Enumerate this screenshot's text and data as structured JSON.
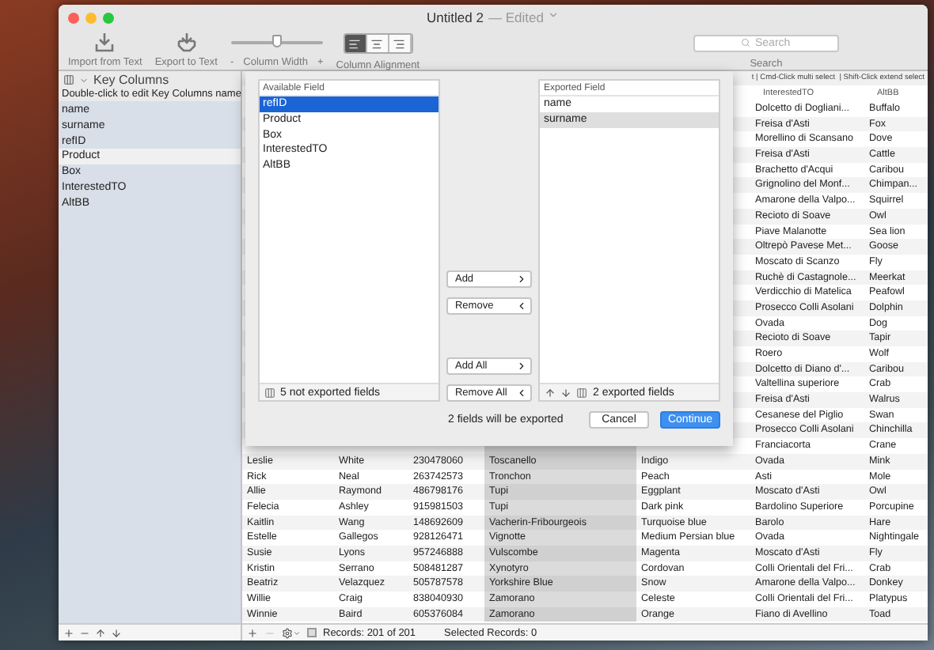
{
  "window": {
    "title": "Untitled 2",
    "edited": "— Edited"
  },
  "toolbar": {
    "import_label": "Import from Text",
    "export_label": "Export to Text",
    "column_width": {
      "label": "Column Width",
      "minus": "-",
      "plus": "+",
      "level": 0.5
    },
    "alignment": {
      "label": "Column Alignment",
      "segments": [
        {
          "kind": "left",
          "selected": true
        },
        {
          "kind": "center",
          "selected": false
        },
        {
          "kind": "right",
          "selected": false
        }
      ]
    },
    "search": {
      "placeholder": "Search",
      "label": "Search"
    }
  },
  "sidebar": {
    "title": "Key Columns",
    "hint": "Double-click to edit Key Columns name",
    "items": [
      {
        "label": "name",
        "selected": false
      },
      {
        "label": "surname",
        "selected": false
      },
      {
        "label": "refID",
        "selected": false
      },
      {
        "label": "Product",
        "selected": true
      },
      {
        "label": "Box",
        "selected": false
      },
      {
        "label": "InterestedTO",
        "selected": false
      },
      {
        "label": "AltBB",
        "selected": false
      }
    ]
  },
  "table": {
    "hint": "t | Cmd-Click multi select  | Shift-Click extend select",
    "column_headers": [
      "InterestedTO",
      "AltBB"
    ],
    "rows": [
      [
        "Dolcetto di Dogliani...",
        "Buffalo"
      ],
      [
        "Freisa d'Asti",
        "Fox"
      ],
      [
        "Morellino di Scansano",
        "Dove"
      ],
      [
        "Freisa d'Asti",
        "Cattle"
      ],
      [
        "Brachetto d'Acqui",
        "Caribou"
      ],
      [
        "Grignolino del Monf...",
        "Chimpan..."
      ],
      [
        "Amarone della Valpo...",
        "Squirrel"
      ],
      [
        "Recioto di Soave",
        "Owl"
      ],
      [
        "Piave Malanotte",
        "Sea lion"
      ],
      [
        "Oltrepò Pavese Met...",
        "Goose"
      ],
      [
        "Moscato di Scanzo",
        "Fly"
      ],
      [
        "Ruchè di Castagnole...",
        "Meerkat"
      ],
      [
        "Verdicchio di Matelica",
        "Peafowl"
      ],
      [
        "Prosecco Colli Asolani",
        "Dolphin"
      ],
      [
        "Ovada",
        "Dog"
      ],
      [
        "Recioto di Soave",
        "Tapir"
      ],
      [
        "Roero",
        "Wolf"
      ],
      [
        "Dolcetto di Diano d'...",
        "Caribou"
      ],
      [
        "Valtellina superiore",
        "Crab"
      ],
      [
        "Freisa d'Asti",
        "Walrus"
      ],
      [
        "Cesanese del Piglio",
        "Swan"
      ],
      [
        "Prosecco Colli Asolani",
        "Chinchilla"
      ],
      [
        "Franciacorta",
        "Crane"
      ],
      [
        "Leslie",
        "White",
        "230478060",
        "Toscanello",
        "Indigo",
        "Ovada",
        "Mink"
      ],
      [
        "Rick",
        "Neal",
        "263742573",
        "Tronchon",
        "Peach",
        "Asti",
        "Mole"
      ],
      [
        "Allie",
        "Raymond",
        "486798176",
        "Tupi",
        "Eggplant",
        "Moscato d'Asti",
        "Owl"
      ],
      [
        "Felecia",
        "Ashley",
        "915981503",
        "Tupi",
        "Dark pink",
        "Bardolino Superiore",
        "Porcupine"
      ],
      [
        "Kaitlin",
        "Wang",
        "148692609",
        "Vacherin-Fribourgeois",
        "Turquoise blue",
        "Barolo",
        "Hare"
      ],
      [
        "Estelle",
        "Gallegos",
        "928126471",
        "Vignotte",
        "Medium Persian blue",
        "Ovada",
        "Nightingale"
      ],
      [
        "Susie",
        "Lyons",
        "957246888",
        "Vulscombe",
        "Magenta",
        "Moscato d'Asti",
        "Fly"
      ],
      [
        "Kristin",
        "Serrano",
        "508481287",
        "Xynotyro",
        "Cordovan",
        "Colli Orientali del Fri...",
        "Crab"
      ],
      [
        "Beatriz",
        "Velazquez",
        "505787578",
        "Yorkshire Blue",
        "Snow",
        "Amarone della Valpo...",
        "Donkey"
      ],
      [
        "Willie",
        "Craig",
        "838040930",
        "Zamorano",
        "Celeste",
        "Colli Orientali del Fri...",
        "Platypus"
      ],
      [
        "Winnie",
        "Baird",
        "605376084",
        "Zamorano",
        "Orange",
        "Fiano di Avellino",
        "Toad"
      ]
    ]
  },
  "status_bar": {
    "records": "Records: 201 of 201",
    "selected": "Selected Records: 0",
    "filter_checked": false
  },
  "export_sheet": {
    "available": {
      "title": "Available Field",
      "items": [
        {
          "label": "refID",
          "selected": true
        },
        {
          "label": "Product",
          "selected": false
        },
        {
          "label": "Box",
          "selected": false
        },
        {
          "label": "InterestedTO",
          "selected": false
        },
        {
          "label": "AltBB",
          "selected": false
        }
      ],
      "footer": "5 not exported fields"
    },
    "buttons": {
      "add": "Add",
      "remove": "Remove",
      "add_all": "Add All",
      "remove_all": "Remove All"
    },
    "exported": {
      "title": "Exported Field",
      "items": [
        {
          "label": "name",
          "selected": false
        },
        {
          "label": "surname",
          "selected": true
        }
      ],
      "footer": "2 exported fields"
    },
    "summary": "2 fields will be exported",
    "cancel": "Cancel",
    "continue": "Continue"
  }
}
